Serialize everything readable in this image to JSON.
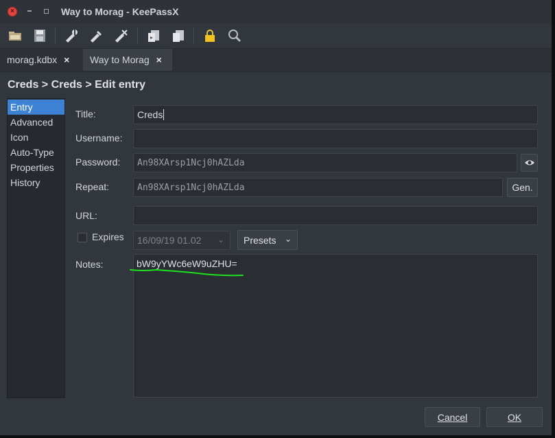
{
  "window": {
    "title": "Way to Morag - KeePassX"
  },
  "toolbar": {
    "icons": [
      "open-database-icon",
      "save-database-icon",
      "add-entry-icon",
      "edit-entry-icon",
      "delete-entry-icon",
      "copy-username-icon",
      "copy-password-icon",
      "lock-database-icon",
      "search-icon"
    ]
  },
  "tabs": [
    {
      "label": "morag.kdbx",
      "close": "×"
    },
    {
      "label": "Way to Morag",
      "close": "×"
    }
  ],
  "breadcrumb": "Creds > Creds > Edit entry",
  "sidebar": {
    "items": [
      {
        "label": "Entry"
      },
      {
        "label": "Advanced"
      },
      {
        "label": "Icon"
      },
      {
        "label": "Auto-Type"
      },
      {
        "label": "Properties"
      },
      {
        "label": "History"
      }
    ]
  },
  "form": {
    "title_label": "Title:",
    "title_value": "Creds",
    "username_label": "Username:",
    "username_value": "",
    "password_label": "Password:",
    "password_value": "An98XArsp1Ncj0hAZLda",
    "repeat_label": "Repeat:",
    "repeat_value": "An98XArsp1Ncj0hAZLda",
    "gen_label": "Gen.",
    "url_label": "URL:",
    "url_value": "",
    "expires_label": "Expires",
    "expires_value": "16/09/19 01.02",
    "presets_label": "Presets",
    "notes_label": "Notes:",
    "notes_value": "bW9yYWc6eW9uZHU="
  },
  "buttons": {
    "cancel": "Cancel",
    "ok": "OK"
  },
  "colors": {
    "accent": "#3e82d4",
    "annotation": "#1ee01e",
    "close_button": "#e0443e"
  }
}
